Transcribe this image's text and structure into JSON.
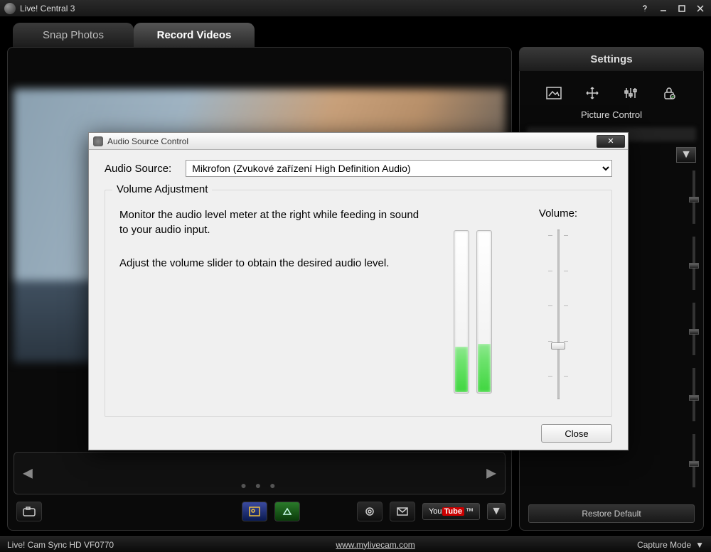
{
  "app": {
    "title": "Live! Central 3"
  },
  "tabs": {
    "snap": "Snap Photos",
    "record": "Record Videos"
  },
  "settings": {
    "header": "Settings",
    "picture_control": "Picture Control",
    "restore": "Restore Default"
  },
  "statusbar": {
    "device": "Live! Cam Sync HD VF0770",
    "url": "www.mylivecam.com",
    "mode": "Capture Mode"
  },
  "toolbar": {
    "youtube_prefix": "You",
    "youtube_suffix": "Tube",
    "youtube_tm": "™"
  },
  "dialog": {
    "title": "Audio Source Control",
    "source_label": "Audio Source:",
    "source_value": "Mikrofon (Zvukové zařízení High Definition Audio)",
    "group_title": "Volume Adjustment",
    "text1": "Monitor the audio level meter at the right while feeding in sound to your audio input.",
    "text2": "Adjust the volume slider to obtain the desired audio level.",
    "volume_label": "Volume:",
    "close": "Close",
    "meter_left_pct": 28,
    "meter_right_pct": 30,
    "volume_slider_pct": 32
  }
}
